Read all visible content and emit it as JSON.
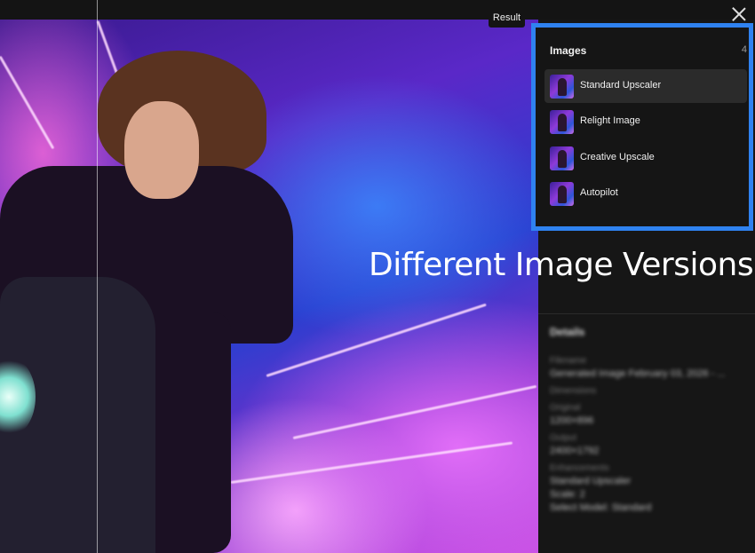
{
  "result_tag": "Result",
  "images_panel": {
    "title": "Images",
    "count": "4",
    "items": [
      {
        "label": "Standard Upscaler",
        "active": true
      },
      {
        "label": "Relight Image",
        "active": false
      },
      {
        "label": "Creative Upscale",
        "active": false
      },
      {
        "label": "Autopilot",
        "active": false
      }
    ]
  },
  "overlay_caption": "Different Image Versions",
  "details": {
    "title": "Details",
    "filename_label": "Filename",
    "filename_value": "Generated Image February 03, 2026 - ...",
    "dimensions_label": "Dimensions",
    "original_label": "Original",
    "original_value": "1200×896",
    "output_label": "Output",
    "output_value": "2400×1792",
    "enhancements_label": "Enhancements",
    "enhancement_1": "Standard Upscaler",
    "enhancement_2": "Scale: 2",
    "enhancement_3": "Select Model: Standard"
  },
  "colors": {
    "highlight_border": "#2f82f0",
    "sidebar_bg": "#161616",
    "active_item_bg": "#2b2b2b"
  },
  "icons": {
    "close": "close-icon"
  }
}
